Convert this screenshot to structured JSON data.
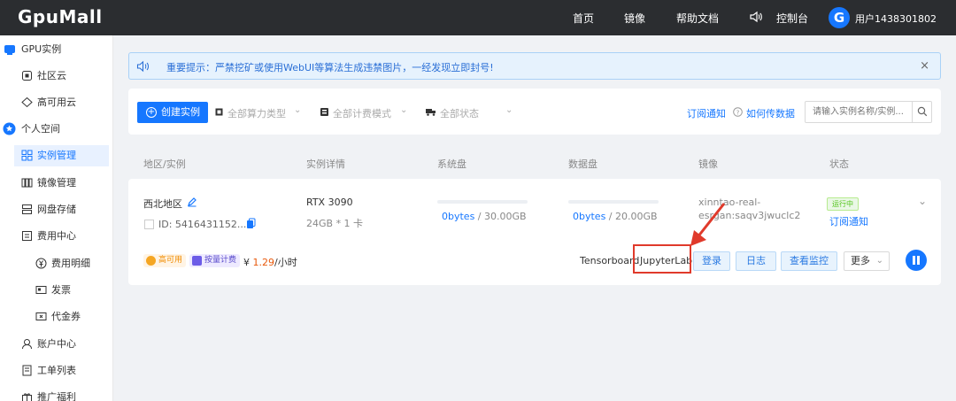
{
  "topbar": {
    "logo": "GpuMall",
    "nav": [
      "首页",
      "镜像",
      "帮助文档",
      "控制台"
    ],
    "avatar_letter": "G",
    "username": "用户1438301802"
  },
  "sidebar": {
    "items": [
      {
        "label": "GPU实例",
        "icon": "gpu-icon"
      },
      {
        "label": "社区云",
        "icon": "community-cloud-icon"
      },
      {
        "label": "高可用云",
        "icon": "cloud-icon"
      },
      {
        "label": "个人空间",
        "icon": "star-icon"
      },
      {
        "label": "实例管理",
        "icon": "grid-icon",
        "active": true
      },
      {
        "label": "镜像管理",
        "icon": "image-icon"
      },
      {
        "label": "网盘存储",
        "icon": "storage-icon"
      },
      {
        "label": "费用中心",
        "icon": "billing-icon"
      },
      {
        "label": "费用明细",
        "icon": "yuan-icon"
      },
      {
        "label": "发票",
        "icon": "invoice-icon"
      },
      {
        "label": "代金券",
        "icon": "coupon-icon"
      },
      {
        "label": "账户中心",
        "icon": "user-icon"
      },
      {
        "label": "工单列表",
        "icon": "ticket-icon"
      },
      {
        "label": "推广福利",
        "icon": "gift-icon"
      }
    ]
  },
  "notice": {
    "text": "重要提示：严禁挖矿或使用WebUI等算法生成违禁图片，一经发现立即封号!",
    "close": "×"
  },
  "filters": {
    "create_label": "创建实例",
    "power_type": "全部算力类型",
    "billing_mode": "全部计费模式",
    "status": "全部状态",
    "subscribe_link": "订阅通知",
    "upload_link": "如何传数据",
    "search_placeholder": "请输入实例名称/实例..."
  },
  "table": {
    "headers": [
      "地区/实例",
      "实例详情",
      "系统盘",
      "数据盘",
      "镜像",
      "状态"
    ]
  },
  "instance": {
    "region": "西北地区",
    "id": "ID: 5416431152...",
    "gpu": "RTX 3090",
    "spec": "24GB * 1 卡",
    "sys_disk_used": "0bytes",
    "sys_disk_total": " / 30.00GB",
    "data_disk_used": "0bytes",
    "data_disk_total": " / 20.00GB",
    "image_line1": "xinntao-real-",
    "image_line2": "esrgan:saqv3jwuclc2",
    "status": "运行中",
    "subscribe": "订阅通知",
    "tag_ha": "高可用",
    "tag_billing": "按量计费",
    "price_symbol": "¥",
    "price_value": "1.29",
    "price_unit": "/小时",
    "actions": {
      "tensorboard": "Tensorboard",
      "jupyter": "JupyterLab",
      "login": "登录",
      "log": "日志",
      "monitor": "查看监控",
      "more": "更多"
    }
  },
  "colors": {
    "accent": "#1677ff",
    "topbar": "#2b2d30",
    "highlight": "#e03a2b"
  }
}
